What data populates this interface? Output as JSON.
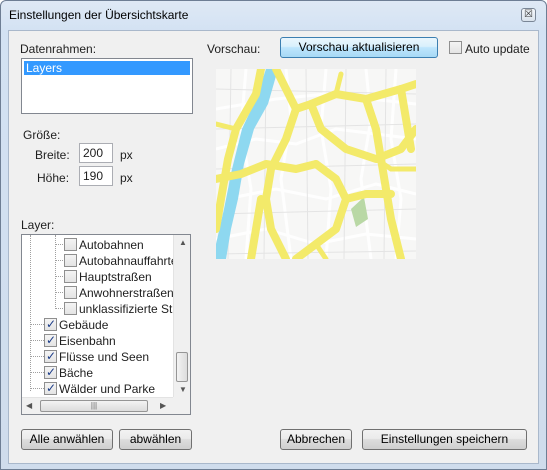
{
  "window": {
    "title": "Einstellungen der Übersichtskarte",
    "close_glyph": "☒"
  },
  "datenrahmen": {
    "label": "Datenrahmen:",
    "items": [
      "Layers"
    ]
  },
  "groesse": {
    "label": "Größe:",
    "breite_label": "Breite:",
    "breite_value": "200",
    "breite_unit": "px",
    "hoehe_label": "Höhe:",
    "hoehe_value": "190",
    "hoehe_unit": "px"
  },
  "layer": {
    "label": "Layer:",
    "items": [
      {
        "label": "Autobahnen",
        "checked": false,
        "level": 2
      },
      {
        "label": "Autobahnauffahrten",
        "checked": false,
        "level": 2
      },
      {
        "label": "Hauptstraßen",
        "checked": false,
        "level": 2
      },
      {
        "label": "Anwohnerstraßen",
        "checked": false,
        "level": 2
      },
      {
        "label": "unklassifizierte Straß",
        "checked": false,
        "level": 2
      },
      {
        "label": "Gebäude",
        "checked": true,
        "level": 1
      },
      {
        "label": "Eisenbahn",
        "checked": true,
        "level": 1
      },
      {
        "label": "Flüsse und Seen",
        "checked": true,
        "level": 1
      },
      {
        "label": "Bäche",
        "checked": true,
        "level": 1
      },
      {
        "label": "Wälder und Parke",
        "checked": true,
        "level": 1
      }
    ],
    "hscroll_grip": "|||"
  },
  "vorschau": {
    "label": "Vorschau:",
    "refresh_button": "Vorschau aktualisieren",
    "auto_update_label": "Auto update",
    "auto_update_checked": false
  },
  "buttons": {
    "select_all": "Alle anwählen",
    "deselect": "abwählen",
    "cancel": "Abbrechen",
    "save": "Einstellungen speichern"
  },
  "map_colors": {
    "road": "#f3ea6a",
    "water": "#8ed8f0",
    "park": "#b9d8a5",
    "background": "#f7f7f6",
    "streets": "#ffffff"
  }
}
